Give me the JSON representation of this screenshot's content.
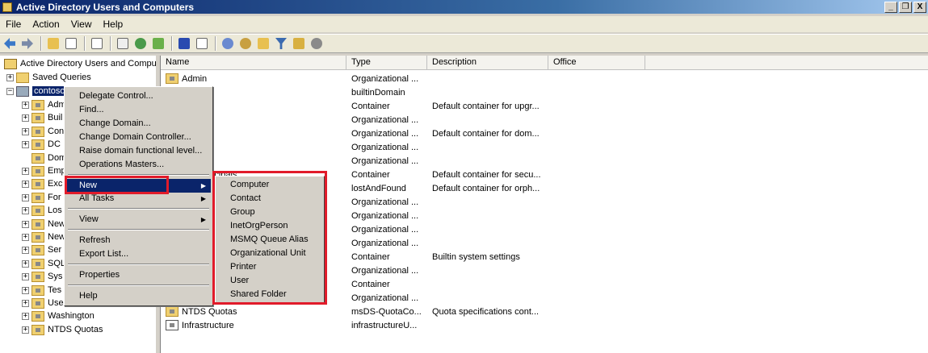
{
  "window": {
    "title": "Active Directory Users and Computers",
    "controls": [
      "_",
      "❐",
      "X"
    ]
  },
  "menubar": [
    "File",
    "Action",
    "View",
    "Help"
  ],
  "tree": {
    "root": "Active Directory Users and Comput",
    "saved_queries": "Saved Queries",
    "domain": "contoso",
    "children": [
      "Adm",
      "Buil",
      "Con",
      "DC",
      "Dom",
      "Emp",
      "Exc",
      "For",
      "Los",
      "New",
      "New",
      "Ser",
      "SQL",
      "Sys",
      "Tes",
      "Use",
      "Washington",
      "NTDS Quotas"
    ]
  },
  "list": {
    "columns": [
      "Name",
      "Type",
      "Description",
      "Office"
    ],
    "rows": [
      {
        "name": "Admin",
        "type": "Organizational ...",
        "desc": ""
      },
      {
        "name": "",
        "type": "builtinDomain",
        "desc": ""
      },
      {
        "name": "s",
        "type": "Container",
        "desc": "Default container for upgr..."
      },
      {
        "name": "",
        "type": "Organizational ...",
        "desc": ""
      },
      {
        "name": "ntrollers",
        "type": "Organizational ...",
        "desc": "Default container for dom..."
      },
      {
        "name": "",
        "type": "Organizational ...",
        "desc": ""
      },
      {
        "name": "Jsers",
        "type": "Organizational ...",
        "desc": ""
      },
      {
        "name": "urityPrincipals",
        "type": "Container",
        "desc": "Default container for secu..."
      },
      {
        "name": "",
        "type": "lostAndFound",
        "desc": "Default container for orph..."
      },
      {
        "name": "",
        "type": "Organizational ...",
        "desc": ""
      },
      {
        "name": "",
        "type": "Organizational ...",
        "desc": ""
      },
      {
        "name": "",
        "type": "Organizational ...",
        "desc": ""
      },
      {
        "name": "",
        "type": "Organizational ...",
        "desc": ""
      },
      {
        "name": "",
        "type": "Container",
        "desc": "Builtin system settings"
      },
      {
        "name": "",
        "type": "Organizational ...",
        "desc": ""
      },
      {
        "name": "",
        "type": "Container",
        "desc": ""
      },
      {
        "name": "",
        "type": "Organizational ...",
        "desc": ""
      },
      {
        "name": "NTDS Quotas",
        "type": "msDS-QuotaCo...",
        "desc": "Quota specifications cont..."
      },
      {
        "name": "Infrastructure",
        "type": "infrastructureU...",
        "desc": ""
      }
    ]
  },
  "context_menu": {
    "items": [
      "Delegate Control...",
      "Find...",
      "Change Domain...",
      "Change Domain Controller...",
      "Raise domain functional level...",
      "Operations Masters...",
      "New",
      "All Tasks",
      "View",
      "Refresh",
      "Export List...",
      "Properties",
      "Help"
    ]
  },
  "submenu_new": [
    "Computer",
    "Contact",
    "Group",
    "InetOrgPerson",
    "MSMQ Queue Alias",
    "Organizational Unit",
    "Printer",
    "User",
    "Shared Folder"
  ],
  "colors": {
    "highlight_box": "#e11b2a",
    "selection": "#0a246a"
  }
}
